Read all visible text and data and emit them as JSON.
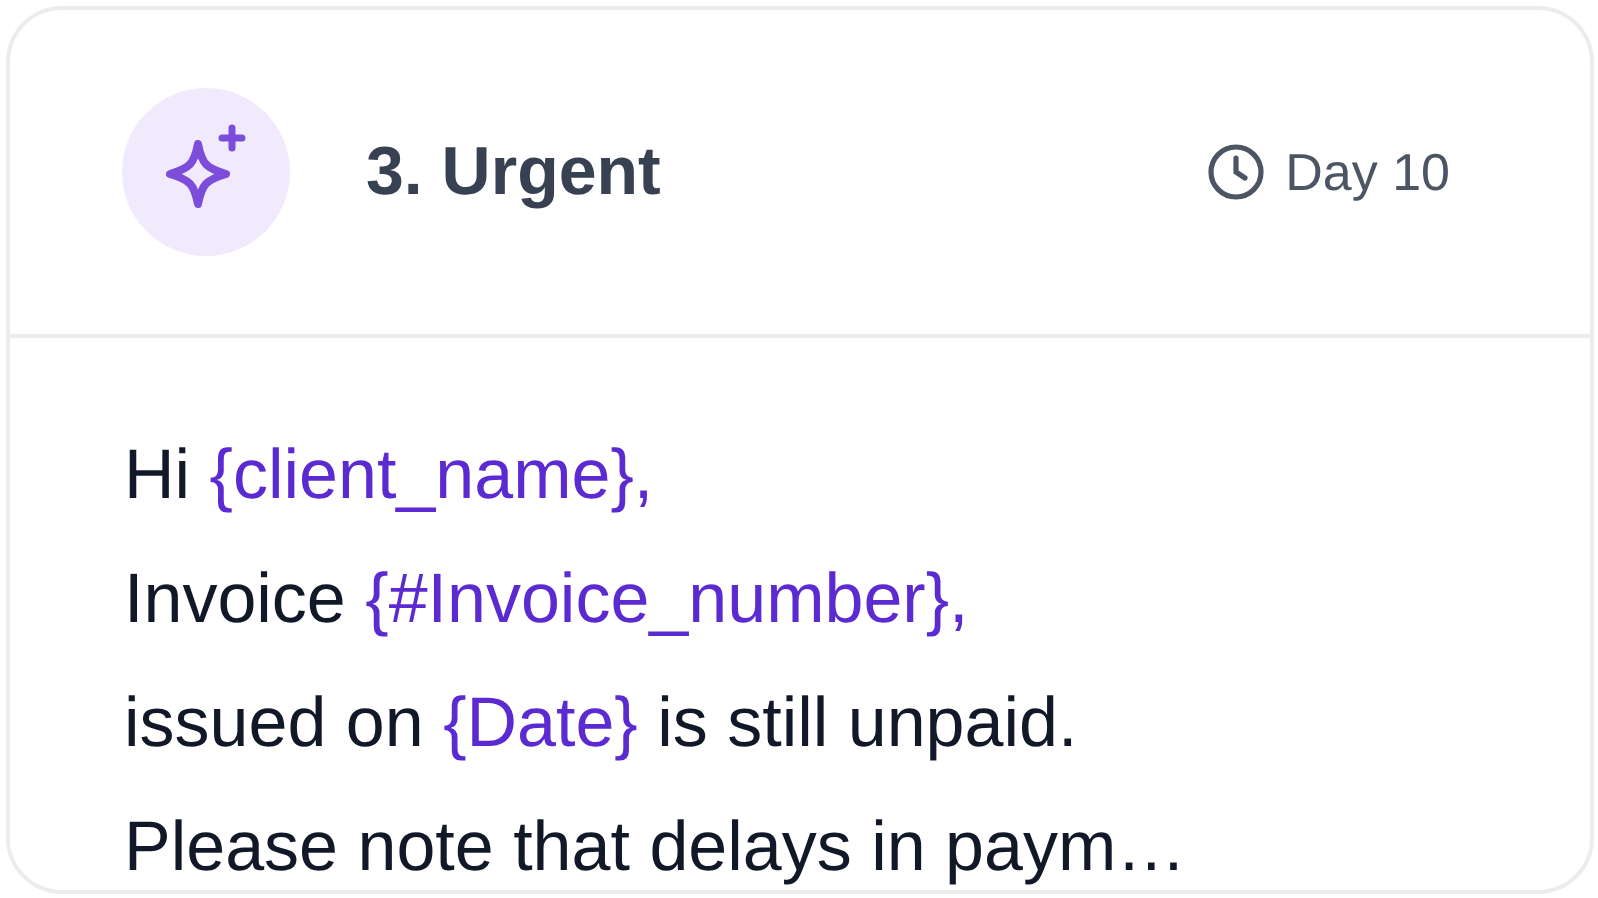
{
  "card": {
    "title": "3. Urgent",
    "timing": "Day 10",
    "message": {
      "lines": [
        [
          {
            "kind": "text",
            "text": "Hi "
          },
          {
            "kind": "variable",
            "text": "{client_name},"
          }
        ],
        [
          {
            "kind": "text",
            "text": "Invoice "
          },
          {
            "kind": "variable",
            "text": "{#Invoice_number},"
          }
        ],
        [
          {
            "kind": "text",
            "text": "issued on "
          },
          {
            "kind": "variable",
            "text": "{Date}"
          },
          {
            "kind": "text",
            "text": " is still unpaid."
          }
        ],
        [
          {
            "kind": "text",
            "text": "Please note that delays in paym…"
          }
        ]
      ]
    }
  }
}
